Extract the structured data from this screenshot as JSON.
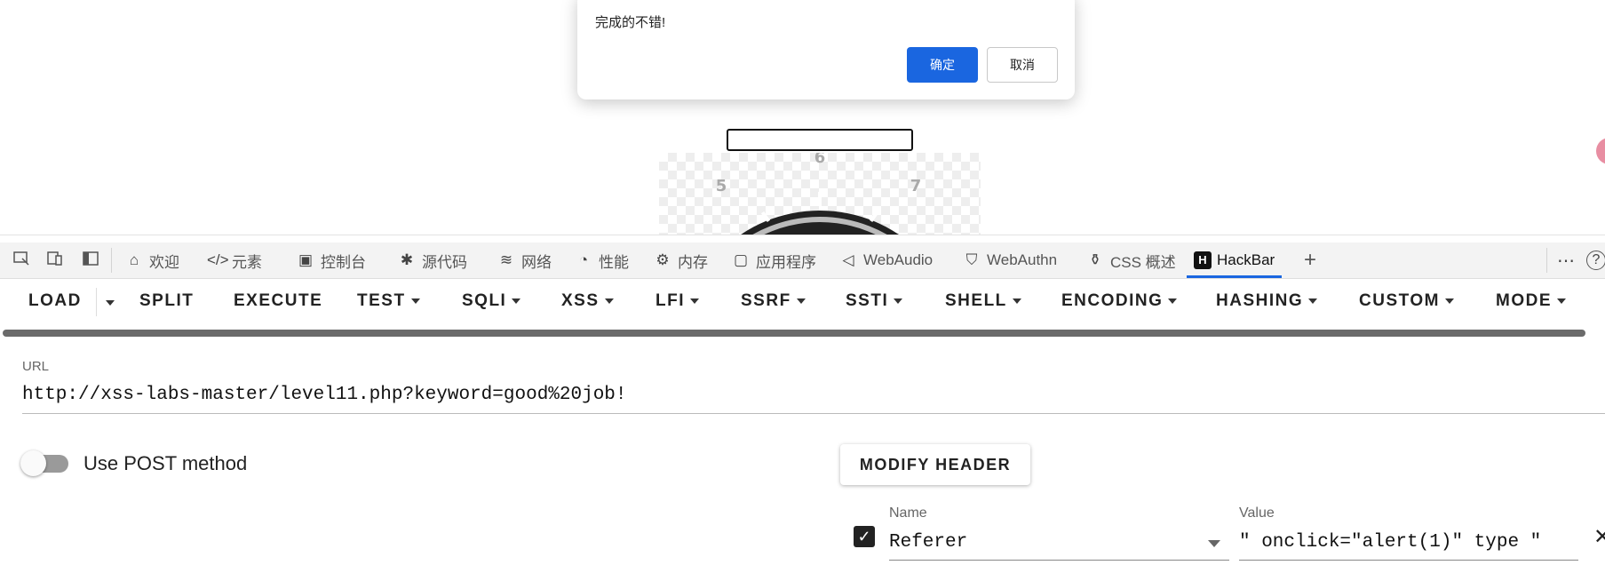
{
  "dialog": {
    "message": "完成的不错!",
    "ok_label": "确定",
    "cancel_label": "取消"
  },
  "page": {
    "clock_numbers": [
      "6",
      "5",
      "7"
    ]
  },
  "devtools": {
    "left_icons": [
      "inspect-icon",
      "device-emulation-icon",
      "sidebar-icon"
    ],
    "tabs": [
      {
        "label": "欢迎",
        "icon": "home-icon"
      },
      {
        "label": "元素",
        "icon": "code-icon"
      },
      {
        "label": "控制台",
        "icon": "console-icon"
      },
      {
        "label": "源代码",
        "icon": "bug-icon"
      },
      {
        "label": "网络",
        "icon": "wifi-icon"
      },
      {
        "label": "性能",
        "icon": "gauge-icon"
      },
      {
        "label": "内存",
        "icon": "chip-icon"
      },
      {
        "label": "应用程序",
        "icon": "window-icon"
      },
      {
        "label": "WebAudio",
        "icon": "speaker-icon"
      },
      {
        "label": "WebAuthn",
        "icon": "shield-icon"
      },
      {
        "label": "CSS 概述",
        "icon": "css-overview-icon"
      },
      {
        "label": "HackBar",
        "icon": "hackbar-logo-icon"
      }
    ],
    "active_tab": "HackBar",
    "accent_color": "#1a66e0"
  },
  "hackbar": {
    "toolbar": {
      "load": "LOAD",
      "split": "SPLIT",
      "execute": "EXECUTE",
      "test": "TEST",
      "sqli": "SQLI",
      "xss": "XSS",
      "lfi": "LFI",
      "ssrf": "SSRF",
      "ssti": "SSTI",
      "shell": "SHELL",
      "encoding": "ENCODING",
      "hashing": "HASHING",
      "custom": "CUSTOM",
      "mode": "MODE"
    },
    "url": {
      "label": "URL",
      "value": "http://xss-labs-master/level11.php?keyword=good%20job!"
    },
    "post_method": {
      "label": "Use POST method",
      "enabled": false
    },
    "modify_header_label": "MODIFY HEADER",
    "header": {
      "checked": true,
      "name_label": "Name",
      "name_value": "Referer",
      "value_label": "Value",
      "value_value": "\" onclick=\"alert(1)\" type \""
    }
  }
}
